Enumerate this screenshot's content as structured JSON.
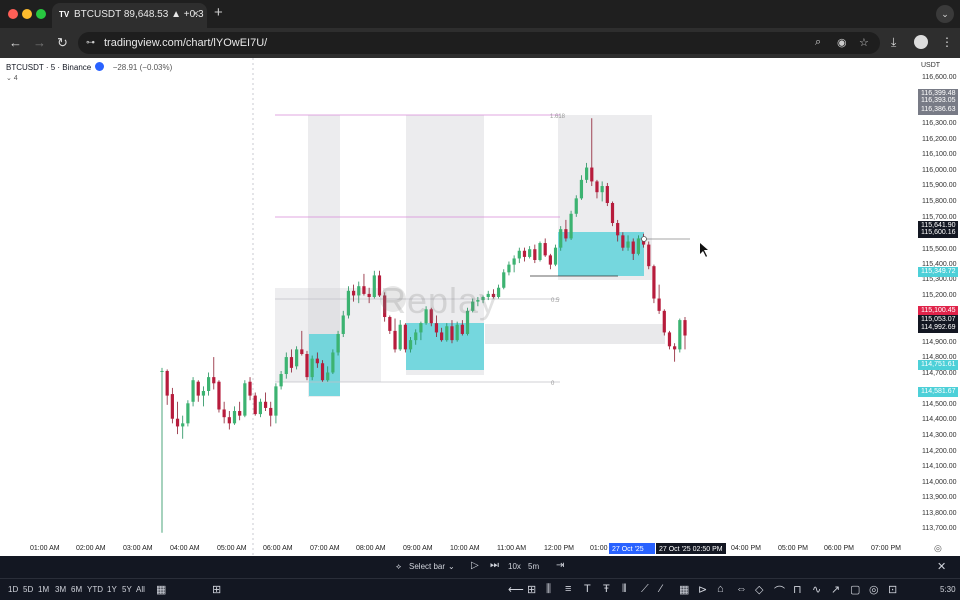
{
  "browser": {
    "tab_title": "BTCUSDT 89,648.53 ▲ +0.3",
    "tab_close": "×",
    "new_tab": "+",
    "tab_menu": "⌄",
    "url": "tradingview.com/chart/lYOwEI7U/",
    "back_icon": "←",
    "forward_icon": "→",
    "reload_icon": "↻",
    "site_icon": "⊶",
    "zoom_icon": "⌕",
    "eye_icon": "◉",
    "star_icon": "☆",
    "download_icon": "⤓",
    "menu_icon": "⋮",
    "traffic_colors": [
      "#ff5f57",
      "#febc2e",
      "#28c840"
    ]
  },
  "legend": {
    "symbol": "BTCUSDT · 5 · Binance",
    "badge": "M",
    "change": "−28.91 (−0.03%)",
    "indicators": "⌄ 4"
  },
  "currency": "USDT",
  "watermark": "Replay",
  "price_axis": [
    "116,600.00",
    "116,300.00",
    "116,200.00",
    "116,100.00",
    "116,000.00",
    "115,900.00",
    "115,800.00",
    "115,700.00",
    "115,500.00",
    "115,400.00",
    "115,300.00",
    "115,200.00",
    "114,900.00",
    "114,800.00",
    "114,700.00",
    "114,500.00",
    "114,400.00",
    "114,300.00",
    "114,200.00",
    "114,100.00",
    "114,000.00",
    "113,900.00",
    "113,800.00",
    "113,700.00"
  ],
  "price_tags": [
    {
      "text": "116,399.48",
      "color": "#787b86"
    },
    {
      "text": "116,393.05",
      "color": "#787b86"
    },
    {
      "text": "116,386.63",
      "color": "#787b86"
    },
    {
      "text": "115,641.90",
      "color": "#131722"
    },
    {
      "text": "115,600.16",
      "color": "#131722"
    },
    {
      "text": "115,349.72",
      "color": "#4dd0d8"
    },
    {
      "text": "115,100.45",
      "color": "#e0234a"
    },
    {
      "text": "115,053.07",
      "color": "#131722"
    },
    {
      "text": "114,992.69",
      "color": "#131722"
    },
    {
      "text": "114,751.61",
      "color": "#4dd0d8"
    },
    {
      "text": "114,581.67",
      "color": "#4dd0d8"
    }
  ],
  "time_axis": [
    "01:00 AM",
    "02:00 AM",
    "03:00 AM",
    "04:00 AM",
    "05:00 AM",
    "06:00 AM",
    "07:00 AM",
    "08:00 AM",
    "09:00 AM",
    "10:00 AM",
    "11:00 AM",
    "12:00 PM",
    "01:00",
    "04:00 PM",
    "05:00 PM",
    "06:00 PM",
    "07:00 PM"
  ],
  "time_highlights": [
    "27 Oct '25  01",
    "27 Oct '25  02:50 PM"
  ],
  "fib_labels": [
    "1.618",
    "0.5",
    "0"
  ],
  "replay_bar": {
    "select_bar": "Select bar",
    "dropdown": "⌄",
    "play_icon": "▷",
    "step_icon": "⏭",
    "speed": "10x",
    "interval": "5m",
    "jump_icon": "⇥",
    "close_icon": "✕",
    "scissor_icon": "⟡"
  },
  "bottom_bar": {
    "ranges": [
      "1D",
      "5D",
      "1M",
      "3M",
      "6M",
      "YTD",
      "1Y",
      "5Y",
      "All"
    ],
    "calendar_icon": "▦",
    "layout_icon": "⊞",
    "time": "5:30",
    "drawing_tools": [
      "⟵",
      "⊞",
      "⫼",
      "≡",
      "T",
      "Ŧ",
      "⫴",
      "⟋",
      "⁄",
      "▦",
      "⊳",
      "⌂",
      "⇔",
      "◇",
      "⌒",
      "⊓",
      "∿",
      "↗",
      "▢",
      "◎",
      "⊡"
    ]
  },
  "candles": [
    {
      "o": 114760,
      "h": 114780,
      "l": 113710,
      "c": 114760
    },
    {
      "o": 114760,
      "h": 114770,
      "l": 114540,
      "c": 114600
    },
    {
      "o": 114610,
      "h": 114650,
      "l": 114420,
      "c": 114450
    },
    {
      "o": 114450,
      "h": 114560,
      "l": 114350,
      "c": 114400
    },
    {
      "o": 114400,
      "h": 114470,
      "l": 114320,
      "c": 114420
    },
    {
      "o": 114420,
      "h": 114570,
      "l": 114400,
      "c": 114550
    },
    {
      "o": 114560,
      "h": 114720,
      "l": 114530,
      "c": 114700
    },
    {
      "o": 114690,
      "h": 114700,
      "l": 114560,
      "c": 114600
    },
    {
      "o": 114600,
      "h": 114660,
      "l": 114530,
      "c": 114630
    },
    {
      "o": 114630,
      "h": 114750,
      "l": 114600,
      "c": 114720
    },
    {
      "o": 114720,
      "h": 114850,
      "l": 114640,
      "c": 114680
    },
    {
      "o": 114690,
      "h": 114700,
      "l": 114490,
      "c": 114510
    },
    {
      "o": 114510,
      "h": 114560,
      "l": 114420,
      "c": 114460
    },
    {
      "o": 114460,
      "h": 114500,
      "l": 114380,
      "c": 114420
    },
    {
      "o": 114420,
      "h": 114530,
      "l": 114410,
      "c": 114500
    },
    {
      "o": 114500,
      "h": 114560,
      "l": 114440,
      "c": 114470
    },
    {
      "o": 114470,
      "h": 114700,
      "l": 114460,
      "c": 114680
    },
    {
      "o": 114690,
      "h": 114720,
      "l": 114570,
      "c": 114600
    },
    {
      "o": 114600,
      "h": 114620,
      "l": 114470,
      "c": 114480
    },
    {
      "o": 114480,
      "h": 114580,
      "l": 114460,
      "c": 114560
    },
    {
      "o": 114560,
      "h": 114620,
      "l": 114500,
      "c": 114520
    },
    {
      "o": 114520,
      "h": 114560,
      "l": 114400,
      "c": 114470
    },
    {
      "o": 114470,
      "h": 114680,
      "l": 114420,
      "c": 114660
    },
    {
      "o": 114660,
      "h": 114760,
      "l": 114640,
      "c": 114740
    },
    {
      "o": 114740,
      "h": 114880,
      "l": 114710,
      "c": 114850
    },
    {
      "o": 114850,
      "h": 114900,
      "l": 114750,
      "c": 114780
    },
    {
      "o": 114790,
      "h": 114920,
      "l": 114770,
      "c": 114900
    },
    {
      "o": 114900,
      "h": 115020,
      "l": 114860,
      "c": 114870
    },
    {
      "o": 114870,
      "h": 114890,
      "l": 114700,
      "c": 114720
    },
    {
      "o": 114720,
      "h": 114860,
      "l": 114700,
      "c": 114840
    },
    {
      "o": 114840,
      "h": 114880,
      "l": 114780,
      "c": 114810
    },
    {
      "o": 114810,
      "h": 114830,
      "l": 114690,
      "c": 114700
    },
    {
      "o": 114700,
      "h": 114790,
      "l": 114690,
      "c": 114750
    },
    {
      "o": 114750,
      "h": 114900,
      "l": 114740,
      "c": 114880
    },
    {
      "o": 114880,
      "h": 115020,
      "l": 114860,
      "c": 115000
    },
    {
      "o": 115000,
      "h": 115150,
      "l": 114980,
      "c": 115120
    },
    {
      "o": 115120,
      "h": 115310,
      "l": 115100,
      "c": 115280
    },
    {
      "o": 115280,
      "h": 115320,
      "l": 115210,
      "c": 115250
    },
    {
      "o": 115250,
      "h": 115340,
      "l": 115200,
      "c": 115310
    },
    {
      "o": 115310,
      "h": 115390,
      "l": 115250,
      "c": 115260
    },
    {
      "o": 115260,
      "h": 115300,
      "l": 115200,
      "c": 115240
    },
    {
      "o": 115240,
      "h": 115410,
      "l": 115230,
      "c": 115380
    },
    {
      "o": 115380,
      "h": 115410,
      "l": 115240,
      "c": 115250
    },
    {
      "o": 115250,
      "h": 115270,
      "l": 115080,
      "c": 115110
    },
    {
      "o": 115110,
      "h": 115120,
      "l": 115000,
      "c": 115020
    },
    {
      "o": 115020,
      "h": 115100,
      "l": 114880,
      "c": 114900
    },
    {
      "o": 114900,
      "h": 115090,
      "l": 114890,
      "c": 115060
    },
    {
      "o": 115060,
      "h": 115070,
      "l": 114880,
      "c": 114900
    },
    {
      "o": 114900,
      "h": 114980,
      "l": 114880,
      "c": 114960
    },
    {
      "o": 114960,
      "h": 115030,
      "l": 114930,
      "c": 115010
    },
    {
      "o": 115010,
      "h": 115080,
      "l": 114960,
      "c": 115070
    },
    {
      "o": 115070,
      "h": 115180,
      "l": 115060,
      "c": 115160
    },
    {
      "o": 115160,
      "h": 115170,
      "l": 115050,
      "c": 115070
    },
    {
      "o": 115070,
      "h": 115120,
      "l": 114980,
      "c": 115010
    },
    {
      "o": 115010,
      "h": 115040,
      "l": 114950,
      "c": 114960
    },
    {
      "o": 114960,
      "h": 115070,
      "l": 114950,
      "c": 115050
    },
    {
      "o": 115050,
      "h": 115090,
      "l": 114940,
      "c": 114960
    },
    {
      "o": 114960,
      "h": 115080,
      "l": 114950,
      "c": 115060
    },
    {
      "o": 115060,
      "h": 115090,
      "l": 114990,
      "c": 115000
    },
    {
      "o": 115000,
      "h": 115170,
      "l": 114990,
      "c": 115150
    },
    {
      "o": 115150,
      "h": 115230,
      "l": 115140,
      "c": 115210
    },
    {
      "o": 115210,
      "h": 115240,
      "l": 115180,
      "c": 115220
    },
    {
      "o": 115220,
      "h": 115250,
      "l": 115200,
      "c": 115240
    },
    {
      "o": 115240,
      "h": 115280,
      "l": 115220,
      "c": 115260
    },
    {
      "o": 115260,
      "h": 115290,
      "l": 115230,
      "c": 115240
    },
    {
      "o": 115240,
      "h": 115320,
      "l": 115230,
      "c": 115300
    },
    {
      "o": 115300,
      "h": 115420,
      "l": 115290,
      "c": 115400
    },
    {
      "o": 115400,
      "h": 115470,
      "l": 115380,
      "c": 115450
    },
    {
      "o": 115450,
      "h": 115510,
      "l": 115400,
      "c": 115490
    },
    {
      "o": 115490,
      "h": 115560,
      "l": 115460,
      "c": 115540
    },
    {
      "o": 115540,
      "h": 115560,
      "l": 115470,
      "c": 115500
    },
    {
      "o": 115500,
      "h": 115570,
      "l": 115490,
      "c": 115550
    },
    {
      "o": 115550,
      "h": 115580,
      "l": 115460,
      "c": 115480
    },
    {
      "o": 115480,
      "h": 115600,
      "l": 115470,
      "c": 115590
    },
    {
      "o": 115590,
      "h": 115620,
      "l": 115500,
      "c": 115510
    },
    {
      "o": 115510,
      "h": 115520,
      "l": 115420,
      "c": 115450
    },
    {
      "o": 115450,
      "h": 115580,
      "l": 115440,
      "c": 115560
    },
    {
      "o": 115560,
      "h": 115700,
      "l": 115540,
      "c": 115680
    },
    {
      "o": 115680,
      "h": 115740,
      "l": 115600,
      "c": 115620
    },
    {
      "o": 115620,
      "h": 115800,
      "l": 115610,
      "c": 115780
    },
    {
      "o": 115780,
      "h": 115900,
      "l": 115760,
      "c": 115880
    },
    {
      "o": 115880,
      "h": 116030,
      "l": 115870,
      "c": 116000
    },
    {
      "o": 116000,
      "h": 116110,
      "l": 115980,
      "c": 116080
    },
    {
      "o": 116080,
      "h": 116400,
      "l": 115960,
      "c": 115990
    },
    {
      "o": 115990,
      "h": 116000,
      "l": 115880,
      "c": 115920
    },
    {
      "o": 115920,
      "h": 115990,
      "l": 115860,
      "c": 115960
    },
    {
      "o": 115960,
      "h": 115980,
      "l": 115830,
      "c": 115850
    },
    {
      "o": 115850,
      "h": 115860,
      "l": 115700,
      "c": 115720
    },
    {
      "o": 115720,
      "h": 115740,
      "l": 115600,
      "c": 115640
    },
    {
      "o": 115640,
      "h": 115660,
      "l": 115540,
      "c": 115560
    },
    {
      "o": 115560,
      "h": 115640,
      "l": 115540,
      "c": 115600
    },
    {
      "o": 115600,
      "h": 115620,
      "l": 115480,
      "c": 115520
    },
    {
      "o": 115520,
      "h": 115640,
      "l": 115510,
      "c": 115620
    },
    {
      "o": 115620,
      "h": 115650,
      "l": 115560,
      "c": 115580
    },
    {
      "o": 115580,
      "h": 115600,
      "l": 115420,
      "c": 115440
    },
    {
      "o": 115440,
      "h": 115450,
      "l": 115200,
      "c": 115230
    },
    {
      "o": 115230,
      "h": 115320,
      "l": 115130,
      "c": 115150
    },
    {
      "o": 115150,
      "h": 115160,
      "l": 114990,
      "c": 115010
    },
    {
      "o": 115010,
      "h": 115020,
      "l": 114900,
      "c": 114920
    },
    {
      "o": 114920,
      "h": 114940,
      "l": 114820,
      "c": 114900
    },
    {
      "o": 114900,
      "h": 115100,
      "l": 114880,
      "c": 115090
    },
    {
      "o": 115090,
      "h": 115110,
      "l": 114900,
      "c": 114990
    }
  ]
}
